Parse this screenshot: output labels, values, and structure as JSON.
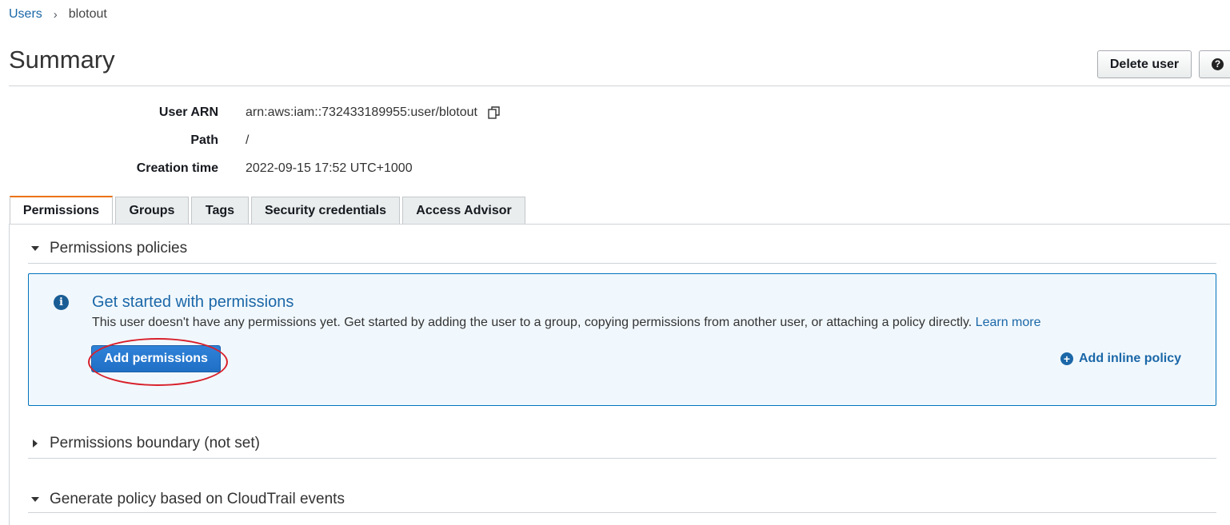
{
  "breadcrumb": {
    "parent": "Users",
    "separator": "›",
    "current": "blotout"
  },
  "header": {
    "title": "Summary",
    "delete_label": "Delete user",
    "help_glyph": "?"
  },
  "summary": {
    "arn_label": "User ARN",
    "arn_value": "arn:aws:iam::732433189955:user/blotout",
    "path_label": "Path",
    "path_value": "/",
    "creation_label": "Creation time",
    "creation_value": "2022-09-15 17:52 UTC+1000"
  },
  "tabs": [
    {
      "label": "Permissions",
      "active": true
    },
    {
      "label": "Groups"
    },
    {
      "label": "Tags"
    },
    {
      "label": "Security credentials"
    },
    {
      "label": "Access Advisor"
    }
  ],
  "permissions": {
    "policies_heading": "Permissions policies",
    "info_glyph": "i",
    "info_title": "Get started with permissions",
    "info_text": "This user doesn't have any permissions yet. Get started by adding the user to a group, copying permissions from another user, or attaching a policy directly.",
    "learn_more": "Learn more",
    "add_permissions": "Add permissions",
    "add_inline_glyph": "+",
    "add_inline": "Add inline policy",
    "boundary_heading": "Permissions boundary (not set)",
    "generate_heading": "Generate policy based on CloudTrail events"
  },
  "colors": {
    "link": "#1b67a8",
    "primary": "#2f82d8",
    "active_tab": "#ec7211",
    "highlight": "#d8202b"
  }
}
